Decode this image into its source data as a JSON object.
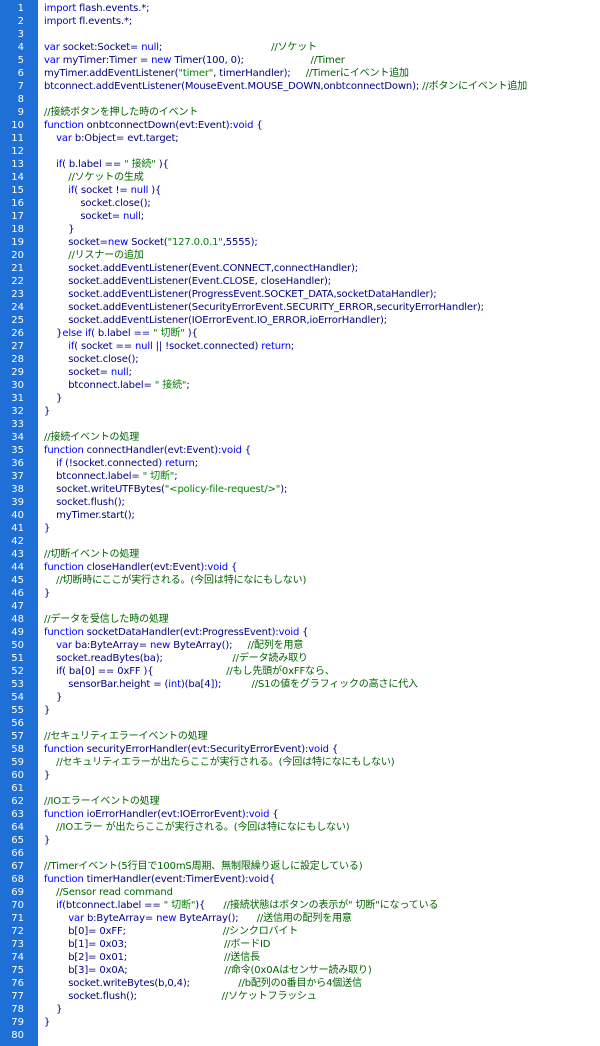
{
  "editor": {
    "lines": [
      {
        "n": "1",
        "text": "import flash.events.*;",
        "kind": "kw"
      },
      {
        "n": "2",
        "text": "import fl.events.*;",
        "kind": "kw"
      },
      {
        "n": "3",
        "text": "",
        "kind": "code"
      },
      {
        "n": "4",
        "text": "var socket:Socket= null;                                    //ソケット",
        "kind": "code"
      },
      {
        "n": "5",
        "text": "var myTimer:Timer = new Timer(100, 0);                      //Timer",
        "kind": "code"
      },
      {
        "n": "6",
        "text": "myTimer.addEventListener(\"timer\", timerHandler);     //Timerにイベント追加",
        "kind": "code"
      },
      {
        "n": "7",
        "text": "btconnect.addEventListener(MouseEvent.MOUSE_DOWN,onbtconnectDown); //ボタンにイベント追加",
        "kind": "code"
      },
      {
        "n": "8",
        "text": "",
        "kind": "code"
      },
      {
        "n": "9",
        "text": "//接続ボタンを押した時のイベント",
        "kind": "cmt"
      },
      {
        "n": "10",
        "text": "function onbtconnectDown(evt:Event):void {",
        "kind": "kw"
      },
      {
        "n": "11",
        "text": "    var b:Object= evt.target;",
        "kind": "code"
      },
      {
        "n": "12",
        "text": "",
        "kind": "code"
      },
      {
        "n": "13",
        "text": "    if( b.label == \" 接続\" ){",
        "kind": "code"
      },
      {
        "n": "14",
        "text": "        //ソケットの生成",
        "kind": "cmt"
      },
      {
        "n": "15",
        "text": "        if( socket != null ){",
        "kind": "code"
      },
      {
        "n": "16",
        "text": "            socket.close();",
        "kind": "code"
      },
      {
        "n": "17",
        "text": "            socket= null;",
        "kind": "code"
      },
      {
        "n": "18",
        "text": "        }",
        "kind": "code"
      },
      {
        "n": "19",
        "text": "        socket=new Socket(\"127.0.0.1\",5555);",
        "kind": "code"
      },
      {
        "n": "20",
        "text": "        //リスナーの追加",
        "kind": "cmt"
      },
      {
        "n": "21",
        "text": "        socket.addEventListener(Event.CONNECT,connectHandler);",
        "kind": "code"
      },
      {
        "n": "22",
        "text": "        socket.addEventListener(Event.CLOSE, closeHandler);",
        "kind": "code"
      },
      {
        "n": "23",
        "text": "        socket.addEventListener(ProgressEvent.SOCKET_DATA,socketDataHandler);",
        "kind": "code"
      },
      {
        "n": "24",
        "text": "        socket.addEventListener(SecurityErrorEvent.SECURITY_ERROR,securityErrorHandler);",
        "kind": "code"
      },
      {
        "n": "25",
        "text": "        socket.addEventListener(IOErrorEvent.IO_ERROR,ioErrorHandler);",
        "kind": "code"
      },
      {
        "n": "26",
        "text": "    }else if( b.label == \" 切断\" ){",
        "kind": "code"
      },
      {
        "n": "27",
        "text": "        if( socket == null || !socket.connected) return;",
        "kind": "code"
      },
      {
        "n": "28",
        "text": "        socket.close();",
        "kind": "code"
      },
      {
        "n": "29",
        "text": "        socket= null;",
        "kind": "code"
      },
      {
        "n": "30",
        "text": "        btconnect.label= \" 接続\";",
        "kind": "code"
      },
      {
        "n": "31",
        "text": "    }",
        "kind": "code"
      },
      {
        "n": "32",
        "text": "}",
        "kind": "code"
      },
      {
        "n": "33",
        "text": "",
        "kind": "code"
      },
      {
        "n": "34",
        "text": "//接続イベントの処理",
        "kind": "cmt"
      },
      {
        "n": "35",
        "text": "function connectHandler(evt:Event):void {",
        "kind": "kw"
      },
      {
        "n": "36",
        "text": "    if (!socket.connected) return;",
        "kind": "code"
      },
      {
        "n": "37",
        "text": "    btconnect.label= \" 切断\";",
        "kind": "code"
      },
      {
        "n": "38",
        "text": "    socket.writeUTFBytes(\"<policy-file-request/>\");",
        "kind": "code"
      },
      {
        "n": "39",
        "text": "    socket.flush();",
        "kind": "code"
      },
      {
        "n": "40",
        "text": "    myTimer.start();",
        "kind": "code"
      },
      {
        "n": "41",
        "text": "}",
        "kind": "code"
      },
      {
        "n": "42",
        "text": "",
        "kind": "code"
      },
      {
        "n": "43",
        "text": "//切断イベントの処理",
        "kind": "cmt"
      },
      {
        "n": "44",
        "text": "function closeHandler(evt:Event):void {",
        "kind": "kw"
      },
      {
        "n": "45",
        "text": "    //切断時にここが実行される。(今回は特になにもしない)",
        "kind": "cmt"
      },
      {
        "n": "46",
        "text": "}",
        "kind": "code"
      },
      {
        "n": "47",
        "text": "",
        "kind": "code"
      },
      {
        "n": "48",
        "text": "//データを受信した時の処理",
        "kind": "cmt"
      },
      {
        "n": "49",
        "text": "function socketDataHandler(evt:ProgressEvent):void {",
        "kind": "kw"
      },
      {
        "n": "50",
        "text": "    var ba:ByteArray= new ByteArray();     //配列を用意",
        "kind": "code"
      },
      {
        "n": "51",
        "text": "    socket.readBytes(ba);                       //データ読み取り",
        "kind": "code"
      },
      {
        "n": "52",
        "text": "    if( ba[0] == 0xFF ){                        //もし先頭が0xFFなら、",
        "kind": "code"
      },
      {
        "n": "53",
        "text": "        sensorBar.height = (int)(ba[4]);          //S1の値をグラフィックの高さに代入",
        "kind": "code"
      },
      {
        "n": "54",
        "text": "    }",
        "kind": "code"
      },
      {
        "n": "55",
        "text": "}",
        "kind": "code"
      },
      {
        "n": "56",
        "text": "",
        "kind": "code"
      },
      {
        "n": "57",
        "text": "//セキュリティエラーイベントの処理",
        "kind": "cmt"
      },
      {
        "n": "58",
        "text": "function securityErrorHandler(evt:SecurityErrorEvent):void {",
        "kind": "kw"
      },
      {
        "n": "59",
        "text": "    //セキュリティエラーが出たらここが実行される。(今回は特になにもしない)",
        "kind": "cmt"
      },
      {
        "n": "60",
        "text": "}",
        "kind": "code"
      },
      {
        "n": "61",
        "text": "",
        "kind": "code"
      },
      {
        "n": "62",
        "text": "//IOエラーイベントの処理",
        "kind": "cmt"
      },
      {
        "n": "63",
        "text": "function ioErrorHandler(evt:IOErrorEvent):void {",
        "kind": "kw"
      },
      {
        "n": "64",
        "text": "    //IOエラー が出たらここが実行される。(今回は特になにもしない)",
        "kind": "cmt"
      },
      {
        "n": "65",
        "text": "}",
        "kind": "code"
      },
      {
        "n": "66",
        "text": "",
        "kind": "code"
      },
      {
        "n": "67",
        "text": "//Timerイベント(5行目で100mS周期、無制限繰り返しに設定している)",
        "kind": "cmt"
      },
      {
        "n": "68",
        "text": "function timerHandler(event:TimerEvent):void{",
        "kind": "kw"
      },
      {
        "n": "69",
        "text": "    //Sensor read command",
        "kind": "cmt"
      },
      {
        "n": "70",
        "text": "    if(btconnect.label == \" 切断\"){      //接続状態はボタンの表示が\" 切断\"になっている",
        "kind": "code"
      },
      {
        "n": "71",
        "text": "        var b:ByteArray= new ByteArray();      //送信用の配列を用意",
        "kind": "code"
      },
      {
        "n": "72",
        "text": "        b[0]= 0xFF;                                //シンクロバイト",
        "kind": "code"
      },
      {
        "n": "73",
        "text": "        b[1]= 0x03;                                //ボードID",
        "kind": "code"
      },
      {
        "n": "74",
        "text": "        b[2]= 0x01;                                //送信長",
        "kind": "code"
      },
      {
        "n": "75",
        "text": "        b[3]= 0x0A;                                //命令(0x0Aはセンサー読み取り)",
        "kind": "code"
      },
      {
        "n": "76",
        "text": "        socket.writeBytes(b,0,4);                //b配列の0番目から4個送信",
        "kind": "code"
      },
      {
        "n": "77",
        "text": "        socket.flush();                            //ソケットフラッシュ",
        "kind": "code"
      },
      {
        "n": "78",
        "text": "    }",
        "kind": "code"
      },
      {
        "n": "79",
        "text": "}",
        "kind": "code"
      },
      {
        "n": "80",
        "text": "",
        "kind": "code"
      }
    ]
  },
  "colors": {
    "gutter": "#1e6fd6",
    "code": "#000080",
    "comment": "#006400",
    "keyword": "#0000ff"
  }
}
